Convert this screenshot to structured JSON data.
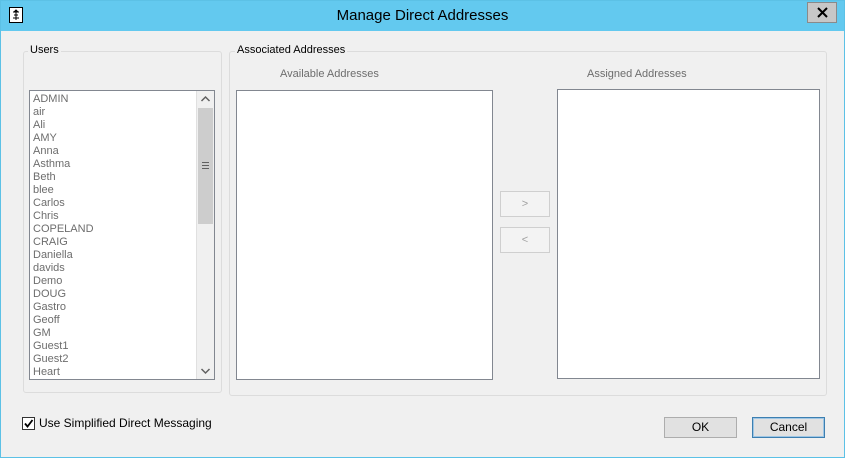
{
  "window": {
    "title": "Manage Direct Addresses"
  },
  "users": {
    "group_label": "Users",
    "items": [
      "ADMIN",
      "air",
      "Ali",
      "AMY",
      "Anna",
      "Asthma",
      "Beth",
      "blee",
      "Carlos",
      "Chris",
      "COPELAND",
      "CRAIG",
      "Daniella",
      "davids",
      "Demo",
      "DOUG",
      "Gastro",
      "Geoff",
      "GM",
      "Guest1",
      "Guest2",
      "Heart"
    ]
  },
  "associated": {
    "group_label": "Associated Addresses",
    "available_title": "Available Addresses",
    "assigned_title": "Assigned Addresses",
    "available_items": [],
    "assigned_items": []
  },
  "buttons": {
    "add_label": ">",
    "remove_label": "<",
    "ok_label": "OK",
    "cancel_label": "Cancel"
  },
  "options": {
    "simplified_label": "Use Simplified Direct Messaging",
    "simplified_checked": true
  },
  "icons": {
    "app": "app-icon",
    "close": "close-icon",
    "scroll_up": "chevron-up-icon",
    "scroll_down": "chevron-down-icon",
    "check": "checkmark-icon"
  }
}
